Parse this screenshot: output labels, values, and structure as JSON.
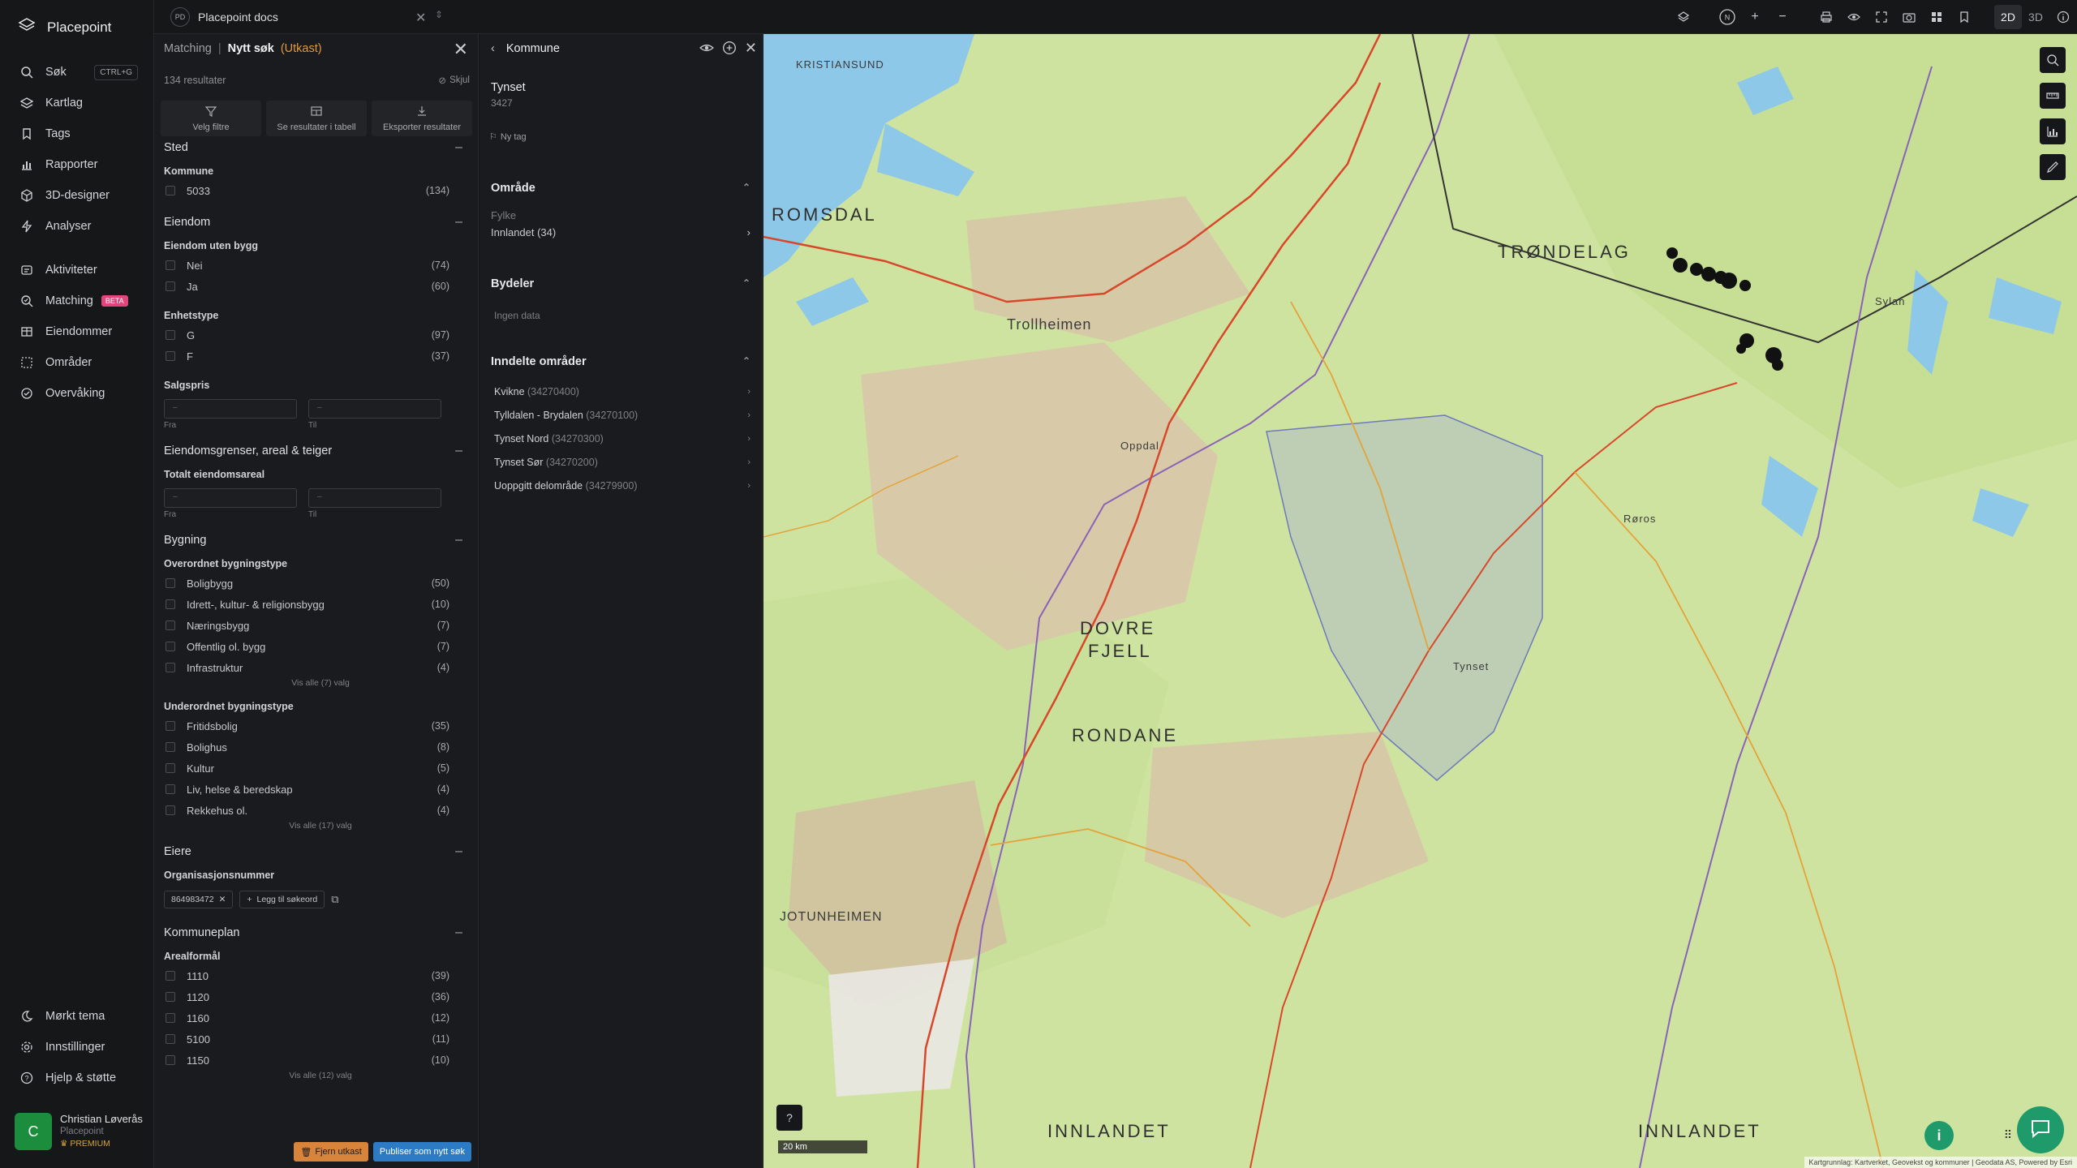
{
  "brand": {
    "name": "Placepoint"
  },
  "nav": {
    "items": [
      {
        "label": "Søk",
        "shortcut": "CTRL+G"
      },
      {
        "label": "Kartlag"
      },
      {
        "label": "Tags"
      },
      {
        "label": "Rapporter"
      },
      {
        "label": "3D-designer"
      },
      {
        "label": "Analyser"
      },
      {
        "label": "Aktiviteter"
      },
      {
        "label": "Matching",
        "badge": "BETA"
      },
      {
        "label": "Eiendommer"
      },
      {
        "label": "Områder"
      },
      {
        "label": "Overvåking"
      }
    ],
    "bottom": [
      {
        "label": "Mørkt tema"
      },
      {
        "label": "Innstillinger"
      },
      {
        "label": "Hjelp & støtte"
      }
    ]
  },
  "user": {
    "initial": "C",
    "name": "Christian Løverås",
    "org": "Placepoint",
    "tier": "PREMIUM"
  },
  "topbar": {
    "doc_badge": "PD",
    "doc_name": "Placepoint docs",
    "mode_2d": "2D",
    "mode_3d": "3D",
    "active_mode": "2D"
  },
  "filter": {
    "crumb": "Matching",
    "title": "Nytt søk",
    "draft": "(Utkast)",
    "result_count": "134 resultater",
    "hide_label": "Skjul",
    "actions": [
      "Velg filtre",
      "Se resultater i tabell",
      "Eksporter resultater"
    ],
    "sections": {
      "sted": {
        "title": "Sted",
        "kommune_label": "Kommune",
        "options": [
          {
            "label": "5033",
            "count": "(134)"
          }
        ]
      },
      "eiendom": {
        "title": "Eiendom",
        "uten_bygg_label": "Eiendom uten bygg",
        "uten_bygg": [
          {
            "label": "Nei",
            "count": "(74)"
          },
          {
            "label": "Ja",
            "count": "(60)"
          }
        ],
        "enhetstype_label": "Enhetstype",
        "enhetstype": [
          {
            "label": "G",
            "count": "(97)"
          },
          {
            "label": "F",
            "count": "(37)"
          }
        ],
        "salgspris_label": "Salgspris",
        "range_from_ph": "–",
        "range_to_ph": "–",
        "from_label": "Fra",
        "to_label": "Til"
      },
      "grenser": {
        "title": "Eiendomsgrenser, areal & teiger",
        "areal_label": "Totalt eiendomsareal"
      },
      "bygning": {
        "title": "Bygning",
        "overordnet_label": "Overordnet bygningstype",
        "overordnet": [
          {
            "label": "Boligbygg",
            "count": "(50)"
          },
          {
            "label": "Idrett-, kultur- & religionsbygg",
            "count": "(10)"
          },
          {
            "label": "Næringsbygg",
            "count": "(7)"
          },
          {
            "label": "Offentlig ol. bygg",
            "count": "(7)"
          },
          {
            "label": "Infrastruktur",
            "count": "(4)"
          }
        ],
        "overordnet_more": "Vis alle (7) valg",
        "underordnet_label": "Underordnet bygningstype",
        "underordnet": [
          {
            "label": "Fritidsbolig",
            "count": "(35)"
          },
          {
            "label": "Bolighus",
            "count": "(8)"
          },
          {
            "label": "Kultur",
            "count": "(5)"
          },
          {
            "label": "Liv, helse & beredskap",
            "count": "(4)"
          },
          {
            "label": "Rekkehus ol.",
            "count": "(4)"
          }
        ],
        "underordnet_more": "Vis alle (17) valg"
      },
      "eiere": {
        "title": "Eiere",
        "org_label": "Organisasjonsnummer",
        "org_value": "864983472",
        "add_keyword": "Legg til søkeord"
      },
      "kommuneplan": {
        "title": "Kommuneplan",
        "arealformal_label": "Arealformål",
        "options": [
          {
            "label": "1110",
            "count": "(39)"
          },
          {
            "label": "1120",
            "count": "(36)"
          },
          {
            "label": "1160",
            "count": "(12)"
          },
          {
            "label": "5100",
            "count": "(11)"
          },
          {
            "label": "1150",
            "count": "(10)"
          }
        ],
        "more": "Vis alle (12) valg"
      }
    },
    "delete_draft": "Fjern utkast",
    "publish": "Publiser som nytt søk"
  },
  "kommune": {
    "title": "Kommune",
    "name": "Tynset",
    "number": "3427",
    "new_tag": "Ny tag",
    "omrade": {
      "title": "Område",
      "fylke_label": "Fylke",
      "fylke_value": "Innlandet (34)"
    },
    "bydeler": {
      "title": "Bydeler",
      "empty": "Ingen data"
    },
    "inndelte": {
      "title": "Inndelte områder",
      "items": [
        {
          "name": "Kvikne",
          "code": "(34270400)"
        },
        {
          "name": "Tylldalen - Brydalen",
          "code": "(34270100)"
        },
        {
          "name": "Tynset Nord",
          "code": "(34270300)"
        },
        {
          "name": "Tynset Sør",
          "code": "(34270200)"
        },
        {
          "name": "Uoppgitt delområde",
          "code": "(34279900)"
        }
      ]
    }
  },
  "map": {
    "scale": "20 km",
    "attribution": "Kartgrunnlag: Kartverket, Geovekst og kommuner | Geodata AS, Powered by Esri",
    "labels": {
      "trondelag": "TRØNDELAG",
      "innlandet": "INNLANDET",
      "innlandet2": "INNLANDET",
      "romsdal": "ROMSDAL",
      "trollheimen": "Trollheimen",
      "dovre": "DOVRE",
      "fjell": "FJELL",
      "rondane": "RONDANE",
      "jotunheimen": "JOTUNHEIMEN",
      "tynset": "Tynset",
      "roros": "Røros",
      "oppdal": "Oppdal",
      "sylan": "Sylan",
      "kristiansund": "KRISTIANSUND"
    },
    "colors": {
      "land": "#cfe3a1",
      "water": "#8ec8e8",
      "mountain": "#d8c3a8",
      "road": "#d9472b",
      "border": "#8a63b8",
      "selection": "#9aa6d8",
      "marker": "#111111"
    }
  }
}
